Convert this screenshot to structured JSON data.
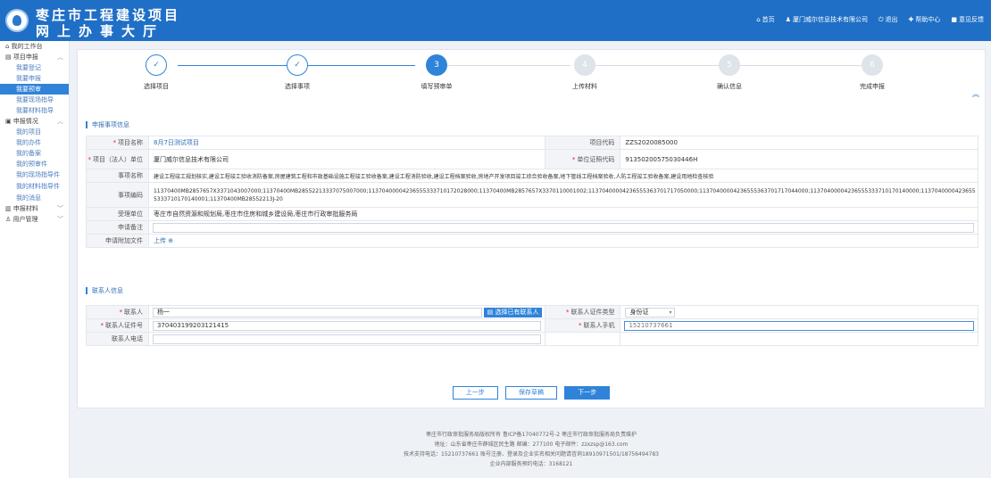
{
  "header": {
    "title_line1": "枣庄市工程建设项目",
    "title_line2": "网上办事大厅",
    "nav": [
      {
        "icon": "home-icon",
        "glyph": "⌂",
        "label": "首页"
      },
      {
        "icon": "user-icon",
        "glyph": "♟",
        "label": "厦门威尔信息技术有限公司"
      },
      {
        "icon": "power-icon",
        "glyph": "⏻",
        "label": "退出"
      },
      {
        "icon": "help-icon",
        "glyph": "✚",
        "label": "帮助中心"
      },
      {
        "icon": "feedback-icon",
        "glyph": "■",
        "label": "意见反馈"
      }
    ]
  },
  "sidebar": {
    "workbench": "我的工作台",
    "project_apply": "项目申报",
    "project_items": [
      "我要登记",
      "我要申报",
      "我要预审",
      "我要现场指导",
      "我要材料指导"
    ],
    "apply_status": "申报情况",
    "status_items": [
      "我的项目",
      "我的办件",
      "我的备案",
      "我的预审件",
      "我的现场指导件",
      "我的材料指导件",
      "我的消息"
    ],
    "materials": "申报材料",
    "users": "用户管理"
  },
  "steps": [
    {
      "label": "选择项目",
      "marker": "✓",
      "state": "done"
    },
    {
      "label": "选择事项",
      "marker": "✓",
      "state": "done"
    },
    {
      "label": "填写预审单",
      "marker": "3",
      "state": "current"
    },
    {
      "label": "上传材料",
      "marker": "4",
      "state": "todo"
    },
    {
      "label": "确认信息",
      "marker": "5",
      "state": "todo"
    },
    {
      "label": "完成申报",
      "marker": "6",
      "state": "todo"
    }
  ],
  "collapse_glyph": "︽",
  "section1": {
    "title": "申报事项信息",
    "project_name_label": "项目名称",
    "project_name": "8月7日测试项目",
    "project_code_label": "项目代码",
    "project_code": "ZZS2020085000",
    "unit_label": "项目（法人）单位",
    "unit": "厦门威尔信息技术有限公司",
    "credit_label": "单位证照代码",
    "credit": "91350200575030446H",
    "items_label": "事项名称",
    "items": "建设工程竣工规划核实,建设工程竣工验收消防备案,房屋建筑工程和市政基础设施工程竣工验收备案,建设工程消防验收,建设工程档案验收,房地产开发项目竣工综合验收备案,地下管线工程档案验收,人防工程竣工验收备案,建设用地检查核验",
    "codes_label": "事项编码",
    "codes": "11370400MB2857657X3371043007000;11370400MB28552213337075007000;11370400004236555333710172028000;11370400MB2857657X3370110001002;11370400004236555363701717050000;11370400004236555363701717044000;11370400004236555333710170140000;11370400004236555333710170140001;11370400MB28552213J-20",
    "dept_label": "受理单位",
    "dept": "枣庄市自然资源和规划局,枣庄市住房和城乡建设局,枣庄市行政审批服务局",
    "remark_label": "申请备注",
    "remark": "",
    "attach_label": "申请附加文件",
    "upload_label": "上传",
    "upload_glyph": "⊕"
  },
  "section2": {
    "title": "联系人信息",
    "contact_label": "联系人",
    "contact": "杨一",
    "pick_button": "选择已有联系人",
    "idtype_label": "联系人证件类型",
    "idtype": "身份证",
    "idno_label": "联系人证件号",
    "idno": "370403199203121415",
    "mobile_label": "联系人手机",
    "mobile": "15210737661",
    "phone_label": "联系人电话",
    "phone": ""
  },
  "buttons": {
    "prev": "上一步",
    "save": "保存草稿",
    "next": "下一步"
  },
  "footer": {
    "line1": "枣庄市行政审批服务局版权所有 鲁ICP备17040772号-2 枣庄市行政审批服务局负责维护",
    "line2": "地址：山东省枣庄市薛城区民生路 邮编：277100 电子邮件：zzxzsp@163.com",
    "line3": "技术支持电话：15210737661 账号注册、登录及企业实名相关问题请咨询18910971501/18756494783",
    "line4": "企业内部服务预约电话：3168121"
  }
}
